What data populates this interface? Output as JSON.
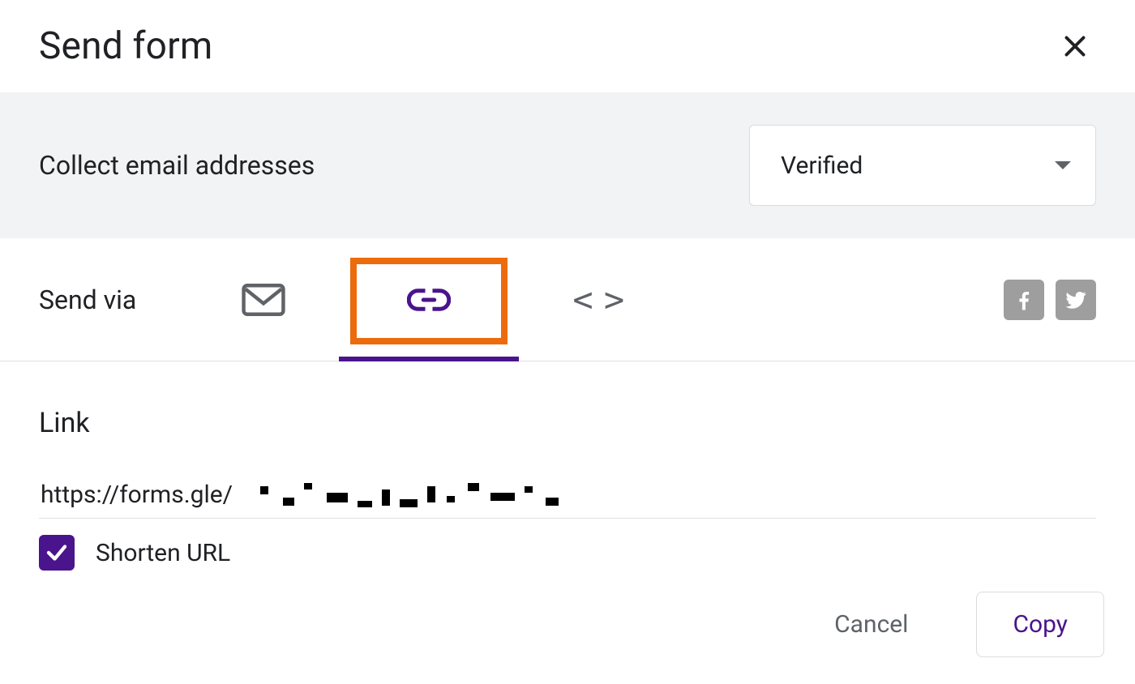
{
  "dialog": {
    "title": "Send form"
  },
  "collect": {
    "label": "Collect email addresses",
    "selected": "Verified"
  },
  "sendvia": {
    "label": "Send via",
    "active_tab": "link"
  },
  "link": {
    "title": "Link",
    "url_visible": "https://forms.gle/",
    "url_rest_redacted": true,
    "shorten_checked": true,
    "shorten_label": "Shorten URL"
  },
  "footer": {
    "cancel": "Cancel",
    "copy": "Copy"
  },
  "colors": {
    "accent": "#4a148c",
    "highlight": "#ec6b0c"
  }
}
